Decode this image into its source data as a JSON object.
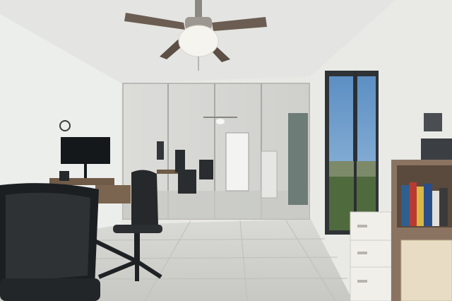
{
  "scene": {
    "kind": "photo",
    "colors": {
      "ceiling": "#e4e5e2",
      "wall_left": "#eceeec",
      "wall_right": "#e9eae6",
      "floor": "#cfd0cb",
      "mirror": "#d6d7d4",
      "door_glass": "#7a8a86",
      "furniture_dark": "#1f2225",
      "furniture_wood": "#7b6550",
      "cabinet": "#f1efe9"
    }
  }
}
